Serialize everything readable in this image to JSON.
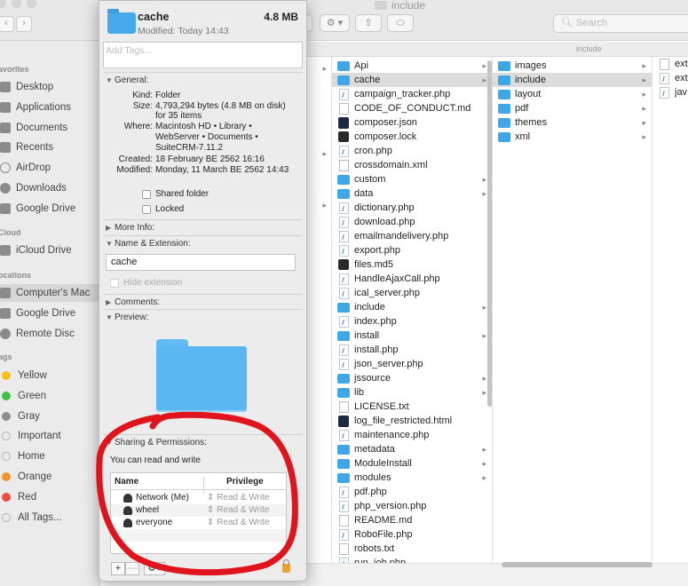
{
  "window": {
    "title": "include",
    "search_placeholder": "Search",
    "path": "include"
  },
  "sidebar": {
    "favorites_head": "avorites",
    "favorites": [
      "Desktop",
      "Applications",
      "Documents",
      "Recents",
      "AirDrop",
      "Downloads",
      "Google Drive"
    ],
    "icloud_head": "Cloud",
    "icloud": [
      "iCloud Drive"
    ],
    "locations_head": "ocations",
    "locations": [
      "Computer's Mac",
      "Google Drive",
      "Remote Disc"
    ],
    "tags_head": "ags",
    "tags": [
      {
        "label": "Yellow",
        "color": "#f5c316"
      },
      {
        "label": "Green",
        "color": "#3cc24a"
      },
      {
        "label": "Gray",
        "color": "#8e8e8e"
      },
      {
        "label": "Important",
        "color": ""
      },
      {
        "label": "Home",
        "color": ""
      },
      {
        "label": "Orange",
        "color": "#f5932a"
      },
      {
        "label": "Red",
        "color": "#ee4b40"
      },
      {
        "label": "All Tags...",
        "color": ""
      }
    ]
  },
  "columns": {
    "main": [
      {
        "name": "Api",
        "kind": "folder",
        "has_children": true
      },
      {
        "name": "cache",
        "kind": "folder",
        "has_children": true,
        "selected": true
      },
      {
        "name": "campaign_tracker.php",
        "kind": "php"
      },
      {
        "name": "CODE_OF_CONDUCT.md",
        "kind": "file"
      },
      {
        "name": "composer.json",
        "kind": "composer"
      },
      {
        "name": "composer.lock",
        "kind": "dark"
      },
      {
        "name": "cron.php",
        "kind": "php"
      },
      {
        "name": "crossdomain.xml",
        "kind": "file"
      },
      {
        "name": "custom",
        "kind": "folder",
        "has_children": true
      },
      {
        "name": "data",
        "kind": "folder",
        "has_children": true
      },
      {
        "name": "dictionary.php",
        "kind": "php"
      },
      {
        "name": "download.php",
        "kind": "php"
      },
      {
        "name": "emailmandelivery.php",
        "kind": "php"
      },
      {
        "name": "export.php",
        "kind": "php"
      },
      {
        "name": "files.md5",
        "kind": "dark"
      },
      {
        "name": "HandleAjaxCall.php",
        "kind": "php"
      },
      {
        "name": "ical_server.php",
        "kind": "php"
      },
      {
        "name": "include",
        "kind": "folder",
        "has_children": true
      },
      {
        "name": "index.php",
        "kind": "php"
      },
      {
        "name": "install",
        "kind": "folder",
        "has_children": true
      },
      {
        "name": "install.php",
        "kind": "php"
      },
      {
        "name": "json_server.php",
        "kind": "php"
      },
      {
        "name": "jssource",
        "kind": "folder",
        "has_children": true
      },
      {
        "name": "lib",
        "kind": "folder",
        "has_children": true
      },
      {
        "name": "LICENSE.txt",
        "kind": "file"
      },
      {
        "name": "log_file_restricted.html",
        "kind": "composer"
      },
      {
        "name": "maintenance.php",
        "kind": "php"
      },
      {
        "name": "metadata",
        "kind": "folder",
        "has_children": true
      },
      {
        "name": "ModuleInstall",
        "kind": "folder",
        "has_children": true
      },
      {
        "name": "modules",
        "kind": "folder",
        "has_children": true
      },
      {
        "name": "pdf.php",
        "kind": "php"
      },
      {
        "name": "php_version.php",
        "kind": "php"
      },
      {
        "name": "README.md",
        "kind": "file"
      },
      {
        "name": "RoboFile.php",
        "kind": "php"
      },
      {
        "name": "robots.txt",
        "kind": "file"
      },
      {
        "name": "run_job.php",
        "kind": "php"
      }
    ],
    "sub": [
      {
        "name": "images",
        "kind": "folder",
        "has_children": true
      },
      {
        "name": "include",
        "kind": "folder",
        "has_children": true,
        "selected": true
      },
      {
        "name": "layout",
        "kind": "folder",
        "has_children": true
      },
      {
        "name": "pdf",
        "kind": "folder",
        "has_children": true
      },
      {
        "name": "themes",
        "kind": "folder",
        "has_children": true
      },
      {
        "name": "xml",
        "kind": "folder",
        "has_children": true
      }
    ],
    "right": [
      {
        "name": "ext",
        "kind": "file"
      },
      {
        "name": "ext",
        "kind": "php"
      },
      {
        "name": "jav",
        "kind": "php"
      }
    ]
  },
  "info": {
    "name": "cache",
    "size_short": "4.8 MB",
    "modified_short": "Modified: Today 14:43",
    "tags_placeholder": "Add Tags...",
    "general_label": "General:",
    "kind_k": "Kind:",
    "kind_v": "Folder",
    "size_k": "Size:",
    "size_v1": "4,793,294 bytes (4.8 MB on disk)",
    "size_v2": "for 35 items",
    "where_k": "Where:",
    "where_v1": "Macintosh HD • Library •",
    "where_v2": "WebServer • Documents •",
    "where_v3": "SuiteCRM-7.11.2",
    "created_k": "Created:",
    "created_v": "18 February BE 2562 16:16",
    "modified_k": "Modified:",
    "modified_v": "Monday, 11 March BE 2562 14:43",
    "shared_folder": "Shared folder",
    "locked": "Locked",
    "more_info": "More Info:",
    "name_ext": "Name & Extension:",
    "name_field": "cache",
    "hide_ext": "Hide extension",
    "comments": "Comments:",
    "preview": "Preview:",
    "sharing": "Sharing & Permissions:",
    "access": "You can read and write",
    "col_name": "Name",
    "col_priv": "Privilege",
    "perms": [
      {
        "user": "Network (Me)",
        "priv": "⇕ Read & Write"
      },
      {
        "user": "wheel",
        "priv": "⇕ Read & Write"
      },
      {
        "user": "everyone",
        "priv": "⇕ Read & Write"
      }
    ],
    "plus": "+",
    "minus": "—",
    "gear": "⚙▾"
  },
  "annotation": {
    "color": "#e0141c"
  }
}
